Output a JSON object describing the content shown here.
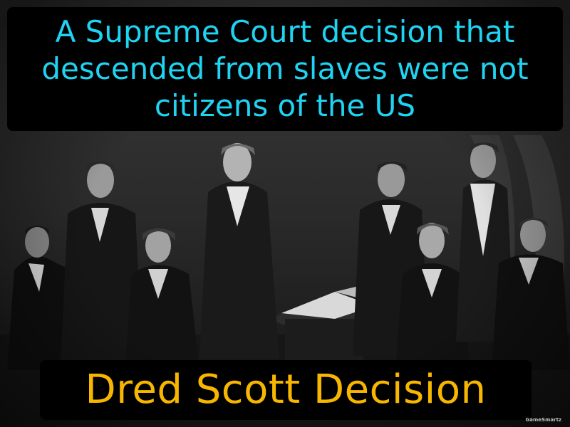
{
  "definition": "A Supreme Court decision that descended from slaves were not citizens of the US",
  "term": "Dred Scott Decision",
  "watermark": "GameSmartz",
  "colors": {
    "definition_text": "#1fd3f2",
    "term_text": "#f7b600",
    "box_background": "#000000"
  }
}
